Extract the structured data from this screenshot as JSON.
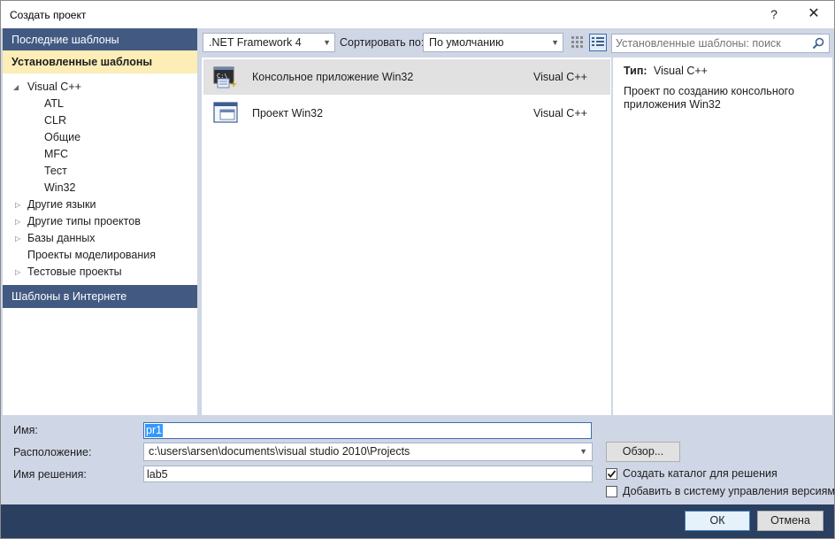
{
  "window": {
    "title": "Создать проект",
    "help_glyph": "?",
    "close_glyph": "✕"
  },
  "left": {
    "recent_label": "Последние шаблоны",
    "installed_label": "Установленные шаблоны",
    "online_label": "Шаблоны в Интернете",
    "tree": [
      {
        "label": "Visual C++",
        "expanded": true
      },
      {
        "label": "ATL"
      },
      {
        "label": "CLR"
      },
      {
        "label": "Общие"
      },
      {
        "label": "MFC"
      },
      {
        "label": "Тест"
      },
      {
        "label": "Win32",
        "selected": true
      },
      {
        "label": "Другие языки",
        "expandable": true
      },
      {
        "label": "Другие типы проектов",
        "expandable": true
      },
      {
        "label": "Базы данных",
        "expandable": true
      },
      {
        "label": "Проекты моделирования"
      },
      {
        "label": "Тестовые проекты",
        "expandable": true
      }
    ]
  },
  "toolbar": {
    "framework": ".NET Framework 4",
    "sort_label": "Сортировать по:",
    "sort_value": "По умолчанию"
  },
  "search": {
    "placeholder": "Установленные шаблоны: поиск"
  },
  "templates": [
    {
      "name": "Консольное приложение Win32",
      "lang": "Visual C++",
      "selected": true
    },
    {
      "name": "Проект Win32",
      "lang": "Visual C++",
      "selected": false
    }
  ],
  "details": {
    "type_label": "Тип:",
    "type_value": "Visual C++",
    "description": "Проект по созданию консольного приложения Win32"
  },
  "form": {
    "name_label": "Имя:",
    "name_value": "pr1",
    "location_label": "Расположение:",
    "location_value": "c:\\users\\arsen\\documents\\visual studio 2010\\Projects",
    "solution_label": "Имя решения:",
    "solution_value": "lab5",
    "browse_label": "Обзор...",
    "create_dir_label": "Создать каталог для решения",
    "create_dir_checked": true,
    "add_vcs_label": "Добавить в систему управления версиями",
    "add_vcs_checked": false,
    "ok_label": "ОК",
    "cancel_label": "Отмена"
  },
  "colors": {
    "header_bg": "#425a82",
    "selected_header_bg": "#fdedb7",
    "client_bg": "#cfd6e5",
    "bottom_bar": "#2b3f60",
    "accent": "#3399ff"
  }
}
